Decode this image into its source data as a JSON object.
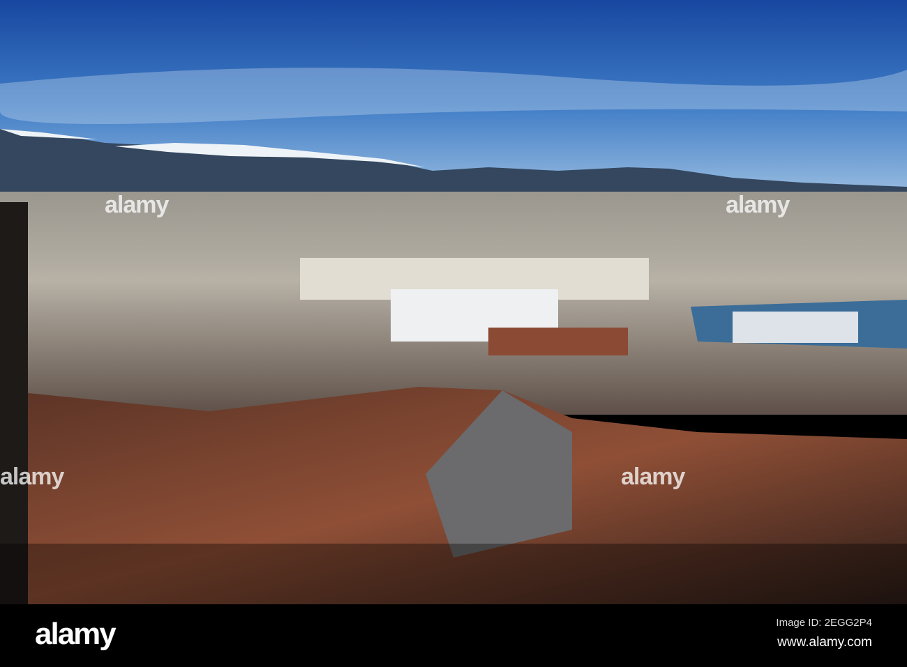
{
  "watermark": "alamy",
  "footer": {
    "logo": "alamy",
    "image_id": "Image ID: 2EGG2P4",
    "website": "www.alamy.com"
  },
  "colors": {
    "sky_top": "#1a4fa0",
    "sky_bottom": "#8fb9e0",
    "mountains": "#34475e",
    "roofs": "#8a4a33"
  }
}
